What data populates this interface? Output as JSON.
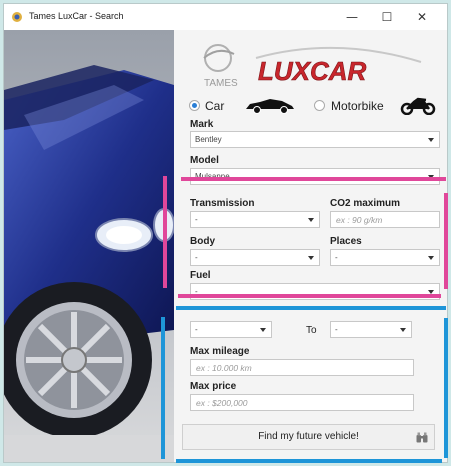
{
  "window": {
    "title": "Tames LuxCar - Search",
    "controls": {
      "minimize": "—",
      "maximize": "☐",
      "close": "✕"
    }
  },
  "logo": {
    "brand": "LUXCAR",
    "sub": "TAMES"
  },
  "vehicle_type": {
    "options": [
      {
        "label": "Car",
        "checked": true
      },
      {
        "label": "Motorbike",
        "checked": false
      }
    ]
  },
  "form": {
    "mark": {
      "label": "Mark",
      "value": "Bentley"
    },
    "model": {
      "label": "Model",
      "value": "Mulsanne"
    },
    "transmission": {
      "label": "Transmission",
      "value": "-"
    },
    "co2": {
      "label": "CO2 maximum",
      "placeholder": "ex : 90 g/km"
    },
    "body": {
      "label": "Body",
      "value": "-"
    },
    "places": {
      "label": "Places",
      "value": "-"
    },
    "fuel": {
      "label": "Fuel",
      "value": "-"
    },
    "year_range": {
      "from": "-",
      "to_label": "To",
      "to": "-"
    },
    "max_mileage": {
      "label": "Max mileage",
      "placeholder": "ex : 10.000 km"
    },
    "max_price": {
      "label": "Max price",
      "placeholder": "ex : $200,000"
    },
    "find_button": "Find my future vehicle!"
  },
  "colors": {
    "annotation_pink": "#e0479a",
    "annotation_blue": "#1e95d8",
    "radio_accent": "#2b7fd6",
    "logo_red": "#c8262c"
  }
}
